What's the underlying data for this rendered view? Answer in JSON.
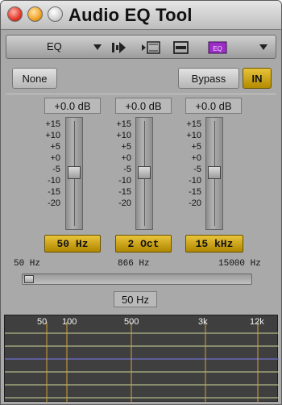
{
  "window": {
    "title": "Audio EQ Tool"
  },
  "toolbar": {
    "mode_label": "EQ"
  },
  "buttons": {
    "none": "None",
    "bypass": "Bypass",
    "in": "IN"
  },
  "bands": [
    {
      "gain": "+0.0 dB",
      "label": "50 Hz",
      "level_db": 0
    },
    {
      "gain": "+0.0 dB",
      "label": "2 Oct",
      "level_db": 0
    },
    {
      "gain": "+0.0 dB",
      "label": "15 kHz",
      "level_db": 0
    }
  ],
  "scale": [
    "+15",
    "+10",
    "+5",
    "+0",
    "-5",
    "-10",
    "-15",
    "-20"
  ],
  "frequency": {
    "min_label": "50 Hz",
    "mid_label": "866 Hz",
    "max_label": "15000 Hz",
    "value": "50 Hz"
  },
  "graph": {
    "labels": [
      "50",
      "100",
      "500",
      "3k",
      "12k"
    ],
    "colors": {
      "background": "#3f3f3f",
      "gridline": "#c8d89a",
      "freqline": "#d4a23a",
      "zero_line": "#6f6fcf"
    }
  }
}
